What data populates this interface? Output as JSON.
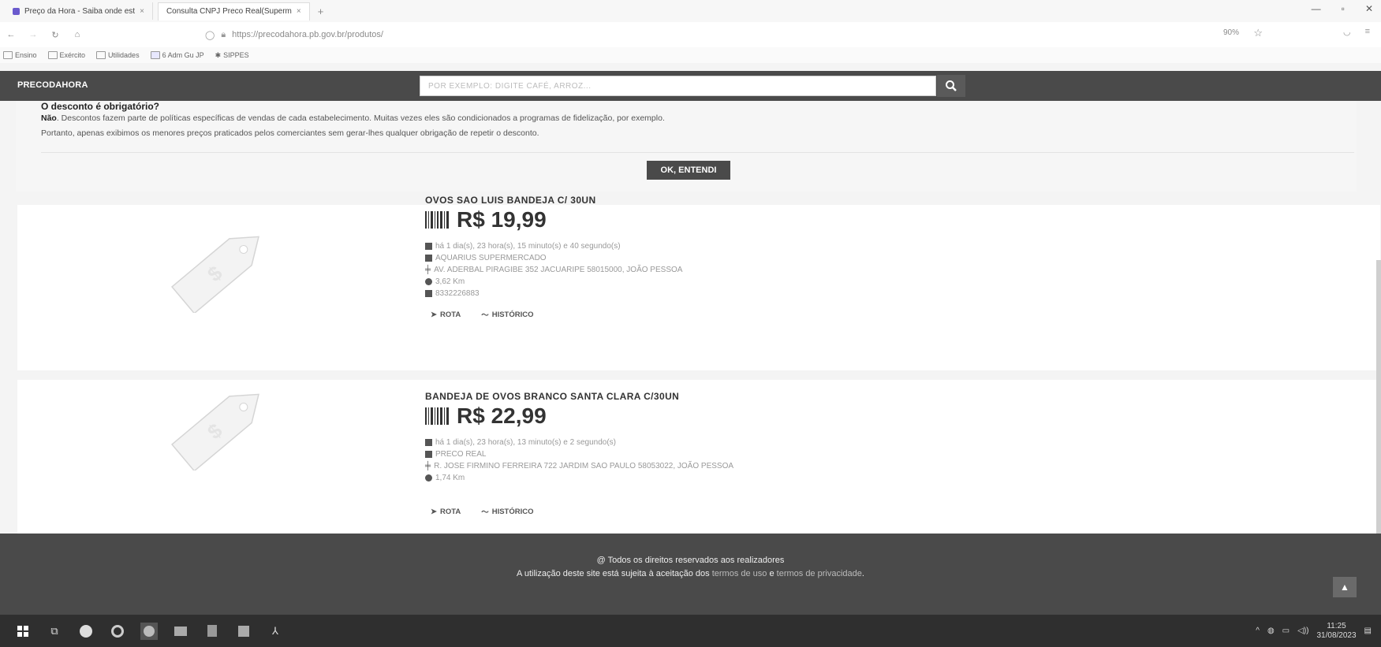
{
  "browser": {
    "tabs": [
      {
        "title": "Preço da Hora - Saiba onde est",
        "close": "×"
      },
      {
        "title": "Consulta CNPJ Preco Real(Superm",
        "close": "×"
      }
    ],
    "new_tab": "+",
    "url": "https://precodahora.pb.gov.br/produtos/",
    "zoom": "90%",
    "bookmarks": [
      "Ensino",
      "Exército",
      "Utilidades",
      "6 Adm Gu JP",
      "SIPPES"
    ]
  },
  "site": {
    "logo": "PRECODAHORA",
    "search_placeholder": "POR EXEMPLO: DIGITE CAFÉ, ARROZ..."
  },
  "notice": {
    "question": "O desconto é obrigatório?",
    "answer_bold": "Não",
    "answer_rest": ". Descontos fazem parte de políticas específicas de vendas de cada estabelecimento. Muitas vezes eles são condicionados a programas de fidelização, por exemplo.",
    "line2": "Portanto, apenas exibimos os menores preços praticados pelos comerciantes sem gerar-lhes qualquer obrigação de repetir o desconto.",
    "ok_button": "OK, ENTENDI"
  },
  "products": [
    {
      "name": "OVOS SAO LUIS BANDEJA C/ 30UN",
      "price": "R$ 19,99",
      "time": "há 1 dia(s), 23 hora(s), 15 minuto(s) e 40 segundo(s)",
      "store": "AQUARIUS SUPERMERCADO",
      "address": "AV. ADERBAL PIRAGIBE 352 JACUARIPE 58015000, JOÃO PESSOA",
      "distance": "3,62 Km",
      "phone": "8332226883",
      "route": "ROTA",
      "history": "HISTÓRICO"
    },
    {
      "name": "BANDEJA DE OVOS BRANCO SANTA CLARA C/30UN",
      "price": "R$ 22,99",
      "time": "há 1 dia(s), 23 hora(s), 13 minuto(s) e 2 segundo(s)",
      "store": "PRECO REAL",
      "address": "R. JOSE FIRMINO FERREIRA 722 JARDIM SAO PAULO 58053022, JOÃO PESSOA",
      "distance": "1,74 Km",
      "route": "ROTA",
      "history": "HISTÓRICO"
    }
  ],
  "footer": {
    "rights": "@ Todos os direitos reservados aos realizadores",
    "usage_pre": "A utilização deste site está sujeita à aceitação dos ",
    "terms": "termos de uso",
    "and": " e ",
    "privacy": "termos de privacidade",
    "end": "."
  },
  "taskbar": {
    "time": "11:25",
    "date": "31/08/2023"
  },
  "icons": [
    "search-icon",
    "calendar-icon",
    "store-icon",
    "road-icon",
    "location-icon",
    "phone-icon",
    "route-arrow-icon",
    "history-chart-icon",
    "arrow-up-icon",
    "price-tag-icon",
    "barcode-icon"
  ]
}
